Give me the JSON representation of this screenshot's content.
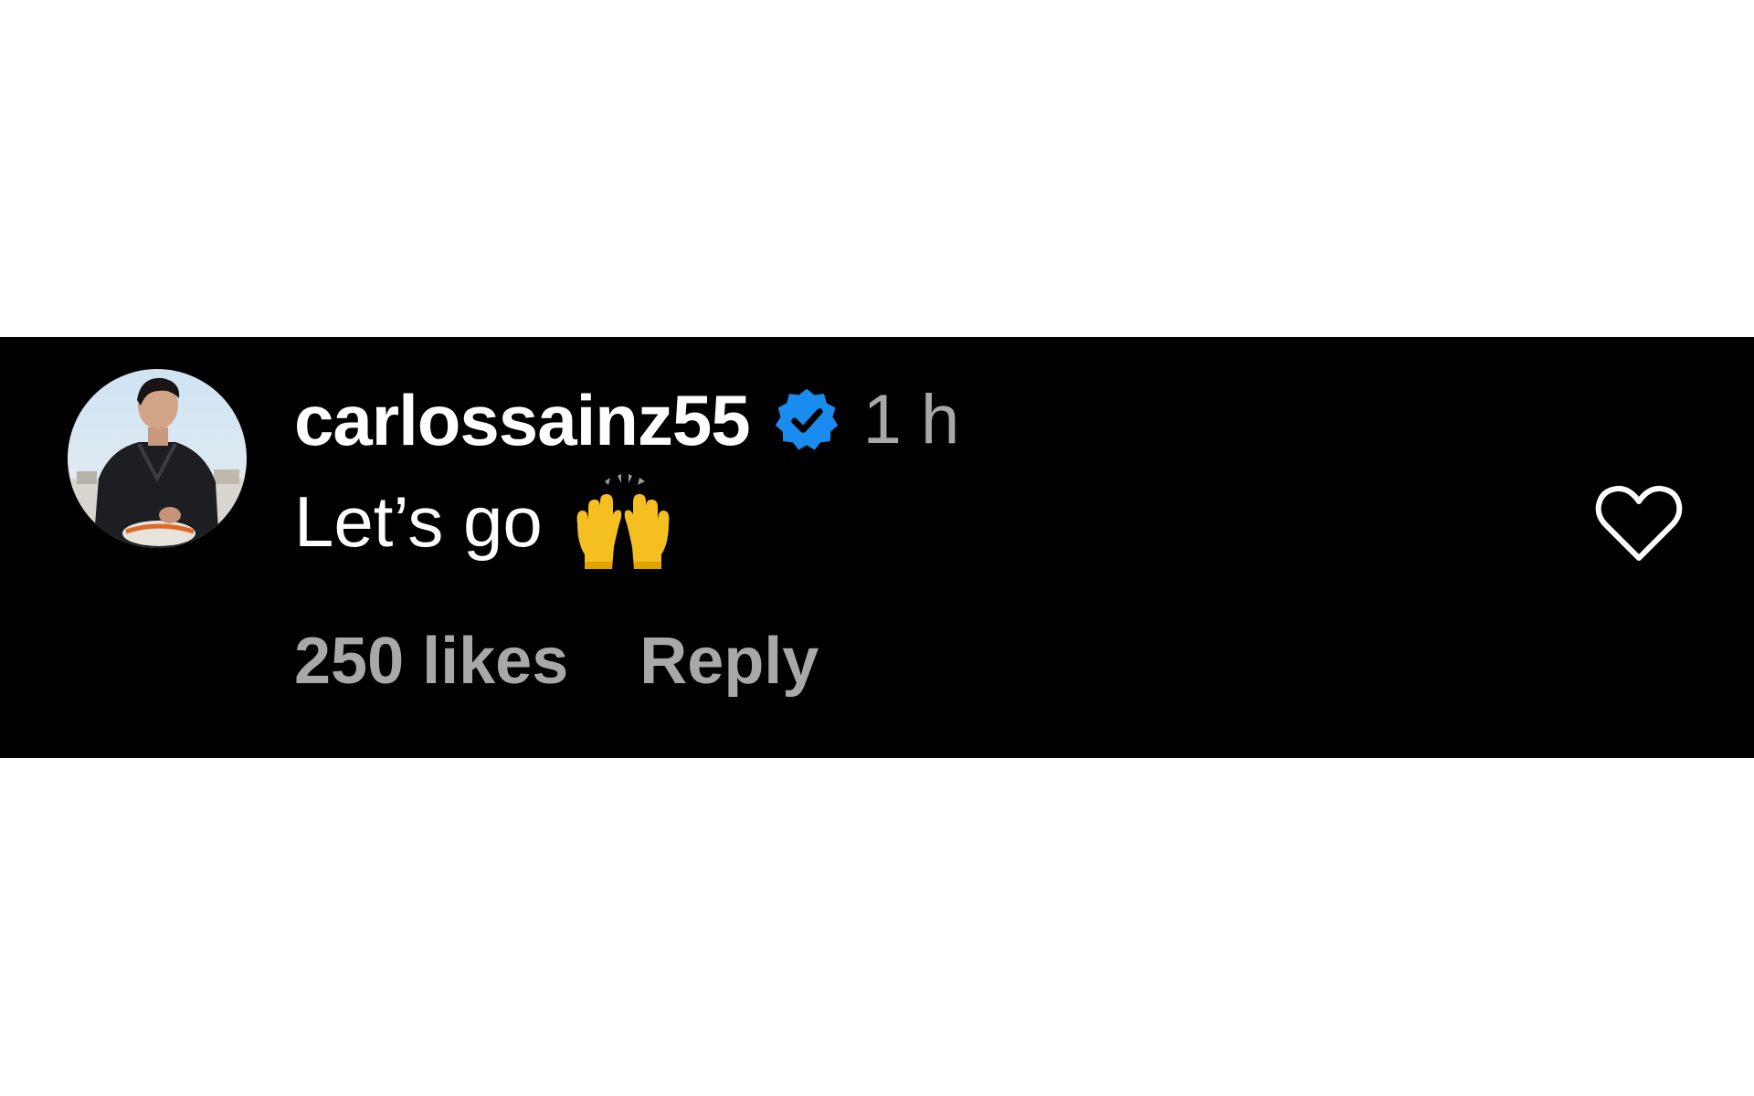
{
  "comment": {
    "username": "carlossainz55",
    "verified_icon": "verified-badge-icon",
    "timestamp": "1 h",
    "text": "Let’s go",
    "emoji_icon": "raising-hands-emoji",
    "likes": "250 likes",
    "reply_label": "Reply",
    "like_icon": "heart-outline-icon"
  },
  "colors": {
    "background": "#000000",
    "username": "#ffffff",
    "secondary_text": "#a8a8a8",
    "verified_blue": "#1a8cf0"
  }
}
